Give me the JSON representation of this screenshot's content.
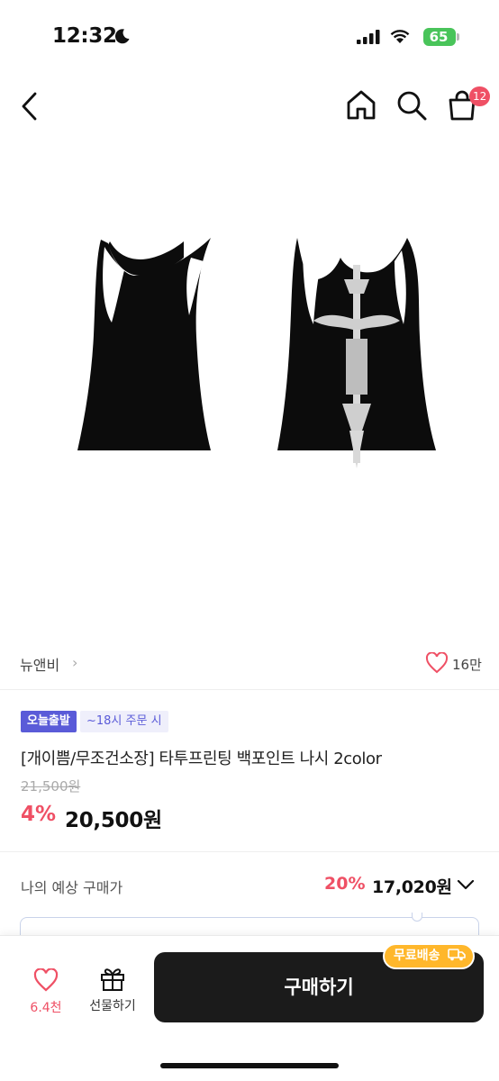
{
  "status": {
    "time": "12:32",
    "battery": "65"
  },
  "nav": {
    "cart_count": "12"
  },
  "brand": {
    "name": "뉴앤비",
    "likes": "16만"
  },
  "product": {
    "delivery_badge": "오늘출발",
    "delivery_note": "~18시 주문 시",
    "title": "[개이쁨/무조건소장] 타투프린팅 백포인트 나시 2color",
    "original_price": "21,500원",
    "discount_rate": "4%",
    "sale_price": "20,500원"
  },
  "estimate": {
    "label": "나의 예상 구매가",
    "rate": "20%",
    "price": "17,020원"
  },
  "bottom": {
    "wish_count": "6.4천",
    "gift_label": "선물하기",
    "buy_label": "구매하기",
    "shipping_tag": "무료배송"
  },
  "colors": {
    "accent": "#ef5065",
    "delivery": "#5a5bd8",
    "shipping": "#ffb72b",
    "buy": "#1b1b1b"
  }
}
